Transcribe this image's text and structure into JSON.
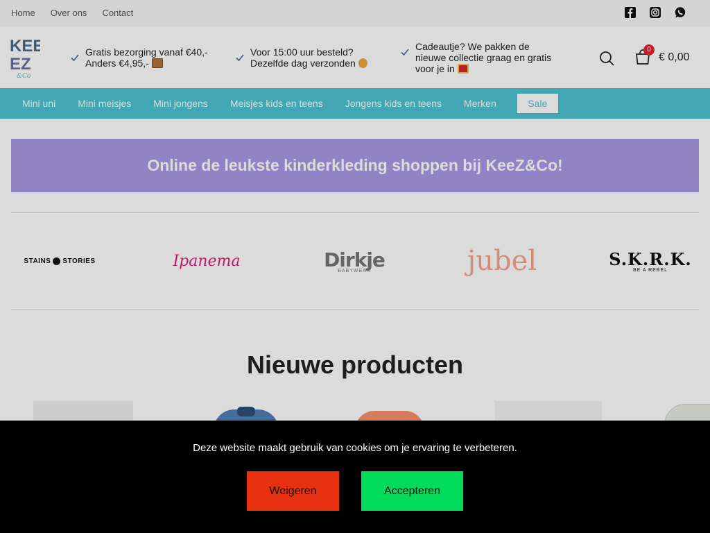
{
  "top_nav": {
    "items": [
      "Home",
      "Over ons",
      "Contact"
    ]
  },
  "socials": [
    "facebook-icon",
    "instagram-icon",
    "whatsapp-icon"
  ],
  "logo": {
    "line1": "KEE",
    "line2": "EZ",
    "tagline": "&Co"
  },
  "usps": [
    {
      "line1": "Gratis bezorging vanaf €40,-",
      "line2": "Anders €4,95,-"
    },
    {
      "line1": "Voor 15:00 uur besteld?",
      "line2": "Dezelfde dag verzonden"
    },
    {
      "line1": "Cadeautje? We pakken de",
      "line2": "nieuwe collectie graag en gratis",
      "line3": "voor je in"
    }
  ],
  "cart": {
    "count": "0",
    "total": "€ 0,00"
  },
  "main_nav": {
    "items": [
      "Mini uni",
      "Mini meisjes",
      "Mini jongens",
      "Meisjes kids en teens",
      "Jongens kids en teens",
      "Merken"
    ],
    "sale": "Sale"
  },
  "banner": {
    "text": "Online de leukste kinderkleding shoppen bij KeeZ&Co!"
  },
  "brands": [
    {
      "left": "STAINS",
      "right": "STORIES"
    },
    {
      "name": "Ipanema"
    },
    {
      "name": "Dirkje",
      "sub": "BABYWEAR"
    },
    {
      "name": "jubel"
    },
    {
      "name": "S.K.R.K.",
      "sub": "BE A REBEL"
    }
  ],
  "section": {
    "title": "Nieuwe producten"
  },
  "cookie": {
    "text": "Deze website maakt gebruik van cookies om je ervaring te verbeteren.",
    "refuse": "Weigeren",
    "accept": "Accepteren"
  },
  "colors": {
    "accent": "#4ec3d1",
    "banner": "#a99ae6",
    "refuse": "#e7300f",
    "accept": "#00dc5a",
    "badge": "#e2262f"
  }
}
